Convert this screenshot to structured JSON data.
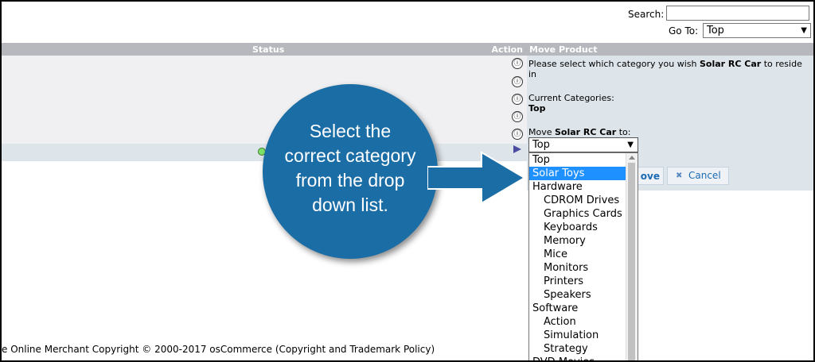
{
  "header": {
    "search_label": "Search:",
    "search_value": "",
    "goto_label": "Go To:",
    "goto_value": "Top"
  },
  "table": {
    "status_header": "Status",
    "action_header": "Action",
    "info_icon_glyph": "ⓘ"
  },
  "move_panel": {
    "title": "Move Product",
    "prompt_prefix": "Please select which category you wish ",
    "product_name": "Solar RC Car",
    "prompt_suffix_1": " to reside",
    "prompt_suffix_2": "in",
    "current_categories_label": "Current Categories:",
    "current_category": "Top",
    "move_label_prefix": "Move ",
    "move_label_suffix": " to:",
    "selected_category": "Top",
    "move_button": "ove",
    "cancel_button": "Cancel"
  },
  "dropdown": {
    "items": [
      {
        "label": "Top",
        "level": 0
      },
      {
        "label": "Solar Toys",
        "level": 0,
        "highlighted": true
      },
      {
        "label": "Hardware",
        "level": 0
      },
      {
        "label": "CDROM Drives",
        "level": 1
      },
      {
        "label": "Graphics Cards",
        "level": 1
      },
      {
        "label": "Keyboards",
        "level": 1
      },
      {
        "label": "Memory",
        "level": 1
      },
      {
        "label": "Mice",
        "level": 1
      },
      {
        "label": "Monitors",
        "level": 1
      },
      {
        "label": "Printers",
        "level": 1
      },
      {
        "label": "Speakers",
        "level": 1
      },
      {
        "label": "Software",
        "level": 0
      },
      {
        "label": "Action",
        "level": 1
      },
      {
        "label": "Simulation",
        "level": 1
      },
      {
        "label": "Strategy",
        "level": 1
      },
      {
        "label": "DVD Movies",
        "level": 0
      }
    ]
  },
  "footer": {
    "text": "e Online Merchant Copyright © 2000-2017 osCommerce (Copyright and Trademark Policy)"
  },
  "callout": {
    "line1": "Select the",
    "line2": "correct category",
    "line3": "from the drop",
    "line4": "down list."
  },
  "colors": {
    "callout_blue": "#1b6da6",
    "highlight_blue": "#1e90ff",
    "header_gray": "#b6b8bd"
  }
}
